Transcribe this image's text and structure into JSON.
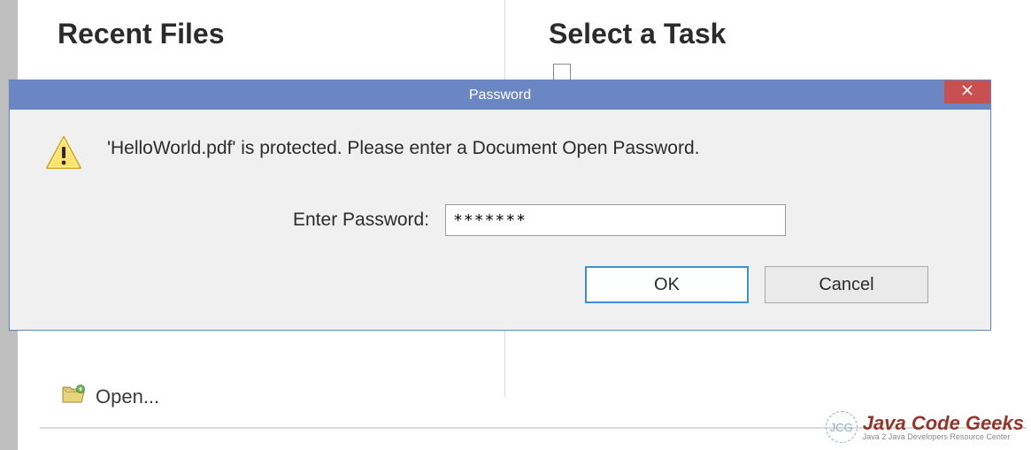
{
  "background": {
    "recent_files_heading": "Recent Files",
    "select_task_heading": "Select a Task",
    "open_label": "Open..."
  },
  "dialog": {
    "title": "Password",
    "message": "'HelloWorld.pdf' is protected. Please enter a Document Open Password.",
    "password_label": "Enter Password:",
    "password_value": "*******",
    "ok_label": "OK",
    "cancel_label": "Cancel"
  },
  "watermark": {
    "badge": "JCG",
    "main": "Java Code Geeks",
    "sub": "Java 2 Java Developers Resource Center"
  }
}
